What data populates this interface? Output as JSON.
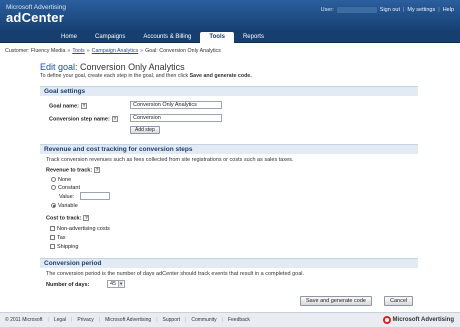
{
  "brand": {
    "top_line": "Microsoft Advertising",
    "product": "adCenter"
  },
  "user_bar": {
    "user_label": "User:",
    "links": [
      "Sign out",
      "My settings",
      "Help"
    ]
  },
  "nav": {
    "tabs": [
      {
        "label": "Home",
        "active": false
      },
      {
        "label": "Campaigns",
        "active": false
      },
      {
        "label": "Accounts & Billing",
        "active": false
      },
      {
        "label": "Tools",
        "active": true
      },
      {
        "label": "Reports",
        "active": false
      }
    ]
  },
  "breadcrumb": {
    "customer": "Customer: Fluency Media",
    "tools": "Tools",
    "campaign_analytics": "Campaign Analytics",
    "current": "Goal: Conversion Only Analytics"
  },
  "page": {
    "title_prefix": "Edit goal:",
    "title_value": "Conversion Only Analytics",
    "intro_text": "To define your goal, create each step in the goal, and then click",
    "intro_bold": "Save and generate code."
  },
  "goal_settings": {
    "heading": "Goal settings",
    "goal_name_label": "Goal name:",
    "goal_name_value": "Conversion Only Analytics",
    "step_name_label": "Conversion step name:",
    "step_name_value": "Conversion",
    "add_step_label": "Add step"
  },
  "revenue": {
    "heading": "Revenue and cost tracking for conversion steps",
    "description": "Track conversion revenues such as fees collected from site registrations or costs such as sales taxes.",
    "revenue_label": "Revenue to track:",
    "options": {
      "none": "None",
      "constant": "Constant",
      "value": "Value:",
      "variable": "Variable"
    },
    "selected": "Variable",
    "cost_label": "Cost to track:",
    "cost_options": [
      "Non-advertising costs",
      "Tax",
      "Shipping"
    ]
  },
  "conversion_period": {
    "heading": "Conversion period",
    "description": "The conversion period is the number of days adCenter should track events that result in a completed goal.",
    "days_label": "Number of days:",
    "days_value": "45"
  },
  "actions": {
    "save_label": "Save and generate code",
    "cancel_label": "Cancel"
  },
  "footer": {
    "copyright": "© 2011 Microsoft",
    "links": [
      "Legal",
      "Privacy",
      "Microsoft Advertising",
      "Support",
      "Community",
      "Feedback"
    ],
    "logo_text": "Microsoft Advertising"
  }
}
